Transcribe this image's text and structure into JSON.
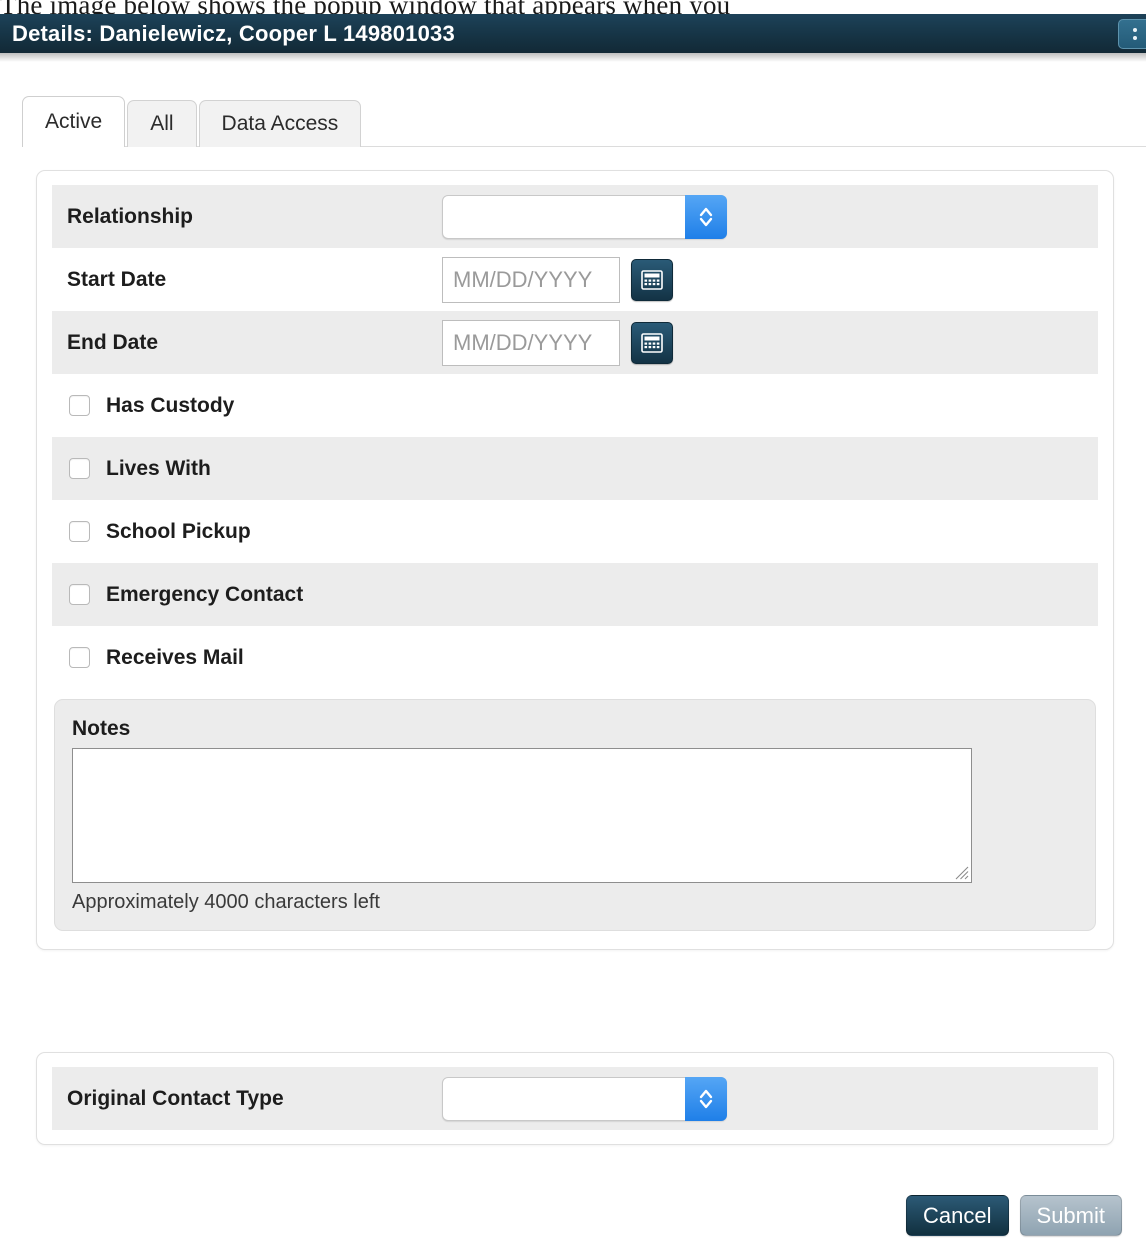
{
  "caption": "The image below shows the popup window that appears when you",
  "titlebar": {
    "title": "Details: Danielewicz, Cooper L 149801033",
    "menu_icon": "kebab-menu-icon"
  },
  "tabs": [
    {
      "label": "Active",
      "active": true
    },
    {
      "label": "All",
      "active": false
    },
    {
      "label": "Data Access",
      "active": false
    }
  ],
  "form": {
    "relationship": {
      "label": "Relationship",
      "value": "",
      "control": "select"
    },
    "start_date": {
      "label": "Start Date",
      "value": "",
      "placeholder": "MM/DD/YYYY",
      "calendar_icon": "calendar-icon"
    },
    "end_date": {
      "label": "End Date",
      "value": "",
      "placeholder": "MM/DD/YYYY",
      "calendar_icon": "calendar-icon"
    },
    "checkboxes": [
      {
        "label": "Has Custody",
        "checked": false
      },
      {
        "label": "Lives With",
        "checked": false
      },
      {
        "label": "School Pickup",
        "checked": false
      },
      {
        "label": "Emergency Contact",
        "checked": false
      },
      {
        "label": "Receives Mail",
        "checked": false
      }
    ],
    "notes": {
      "label": "Notes",
      "value": "",
      "hint": "Approximately 4000 characters left"
    },
    "original_contact_type": {
      "label": "Original Contact Type",
      "value": "",
      "control": "select"
    }
  },
  "footer": {
    "cancel_label": "Cancel",
    "submit_label": "Submit"
  },
  "colors": {
    "titlebar": "#163445",
    "accent_blue": "#1f7fe8",
    "row_stripe": "#ececec",
    "cancel_button": "#1c4459",
    "submit_button": "#9fb1bd"
  }
}
